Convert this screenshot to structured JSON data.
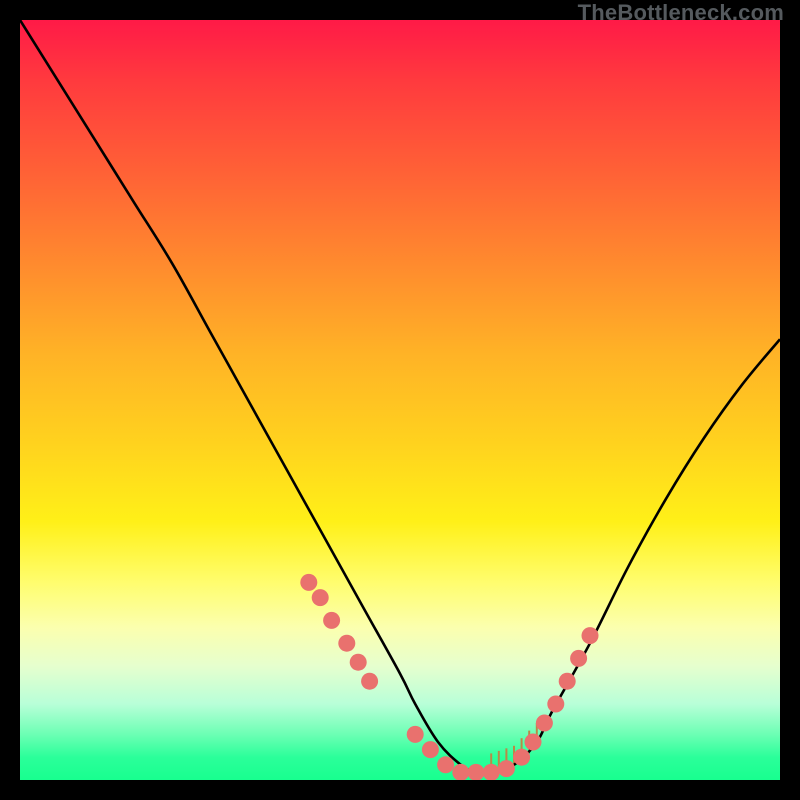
{
  "watermark": "TheBottleneck.com",
  "chart_data": {
    "type": "line",
    "title": "",
    "xlabel": "",
    "ylabel": "",
    "xlim": [
      0,
      100
    ],
    "ylim": [
      0,
      100
    ],
    "series": [
      {
        "name": "bottleneck-curve",
        "x": [
          0,
          5,
          10,
          15,
          20,
          25,
          30,
          35,
          40,
          45,
          50,
          52,
          55,
          58,
          60,
          62,
          65,
          68,
          70,
          75,
          80,
          85,
          90,
          95,
          100
        ],
        "y": [
          100,
          92,
          84,
          76,
          68,
          59,
          50,
          41,
          32,
          23,
          14,
          10,
          5,
          2,
          1,
          1,
          2,
          5,
          9,
          18,
          28,
          37,
          45,
          52,
          58
        ]
      }
    ],
    "markers": {
      "name": "highlighted-points",
      "color": "#e9716e",
      "x": [
        38,
        39.5,
        41,
        43,
        44.5,
        46,
        52,
        54,
        56,
        58,
        60,
        62,
        64,
        66,
        67.5,
        69,
        70.5,
        72,
        73.5,
        75
      ],
      "y": [
        26,
        24,
        21,
        18,
        15.5,
        13,
        6,
        4,
        2,
        1,
        1,
        1,
        1.5,
        3,
        5,
        7.5,
        10,
        13,
        16,
        19
      ]
    },
    "ticks": {
      "x": [
        62,
        63,
        64,
        65,
        66,
        67,
        68
      ],
      "len": 2.5
    },
    "background_gradient": {
      "top": "#ff1a47",
      "middle": "#ffd31e",
      "bottom": "#18ff8f"
    }
  }
}
